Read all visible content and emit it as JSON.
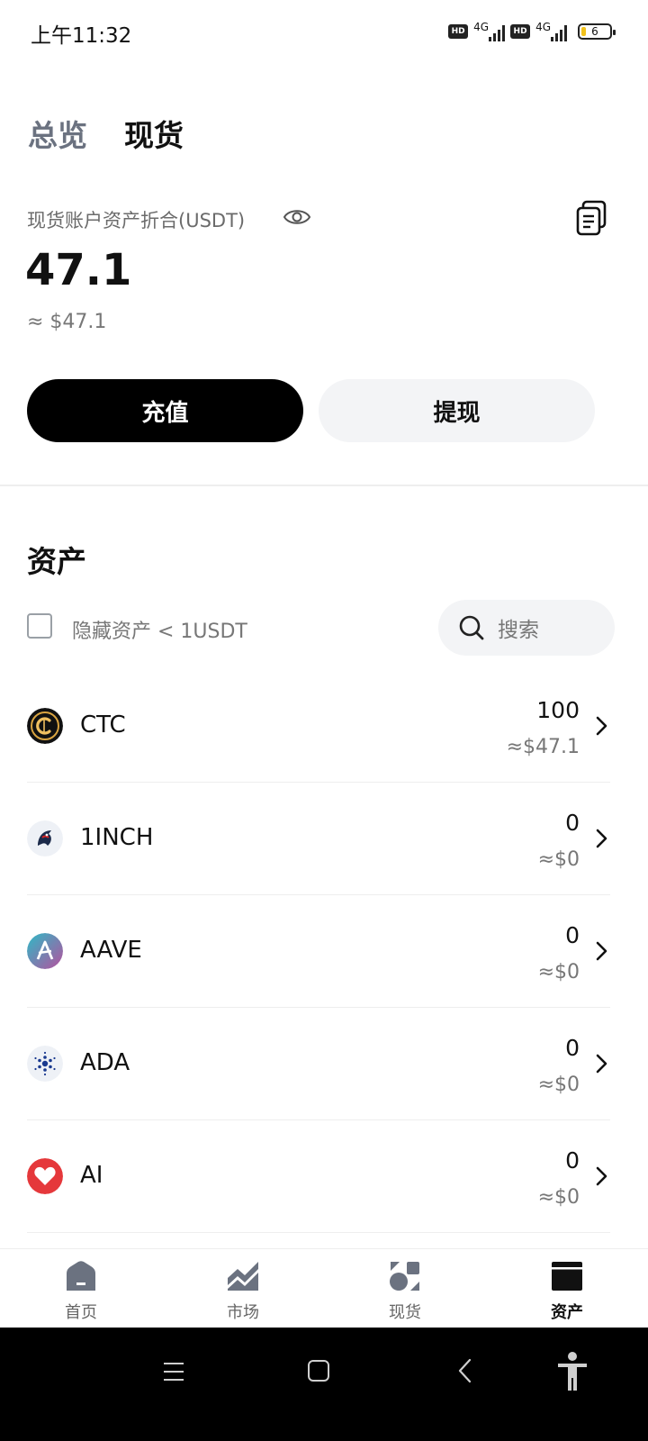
{
  "status_bar": {
    "time": "上午11:32",
    "hd1": "HD",
    "net1": "4G",
    "hd2": "HD",
    "net2": "4G",
    "battery": "6"
  },
  "tabs": [
    {
      "label": "总览",
      "active": false
    },
    {
      "label": "现货",
      "active": true
    }
  ],
  "account": {
    "label": "现货账户资产折合(USDT)",
    "balance": "47.1",
    "balance_usd": "≈ $47.1"
  },
  "actions": {
    "deposit": "充值",
    "withdraw": "提现"
  },
  "assets_section": {
    "title": "资产",
    "hide_small_label": "隐藏资产 < 1USDT",
    "hide_small_checked": false,
    "search_placeholder": "搜索"
  },
  "assets": [
    {
      "symbol": "CTC",
      "amount": "100",
      "value": "≈$47.1",
      "icon": "ctc-coin-icon"
    },
    {
      "symbol": "1INCH",
      "amount": "0",
      "value": "≈$0",
      "icon": "1inch-coin-icon"
    },
    {
      "symbol": "AAVE",
      "amount": "0",
      "value": "≈$0",
      "icon": "aave-coin-icon"
    },
    {
      "symbol": "ADA",
      "amount": "0",
      "value": "≈$0",
      "icon": "ada-coin-icon"
    },
    {
      "symbol": "AI",
      "amount": "0",
      "value": "≈$0",
      "icon": "ai-coin-icon"
    }
  ],
  "bottom_nav": [
    {
      "label": "首页",
      "icon": "home-icon",
      "active": false
    },
    {
      "label": "市场",
      "icon": "market-chart-icon",
      "active": false
    },
    {
      "label": "现货",
      "icon": "spot-icon",
      "active": false
    },
    {
      "label": "资产",
      "icon": "wallet-icon",
      "active": true
    }
  ],
  "colors": {
    "primary": "#000000",
    "muted_text": "#777777",
    "secondary_bg": "#f3f4f6",
    "overview_tab": "#6b7280"
  }
}
